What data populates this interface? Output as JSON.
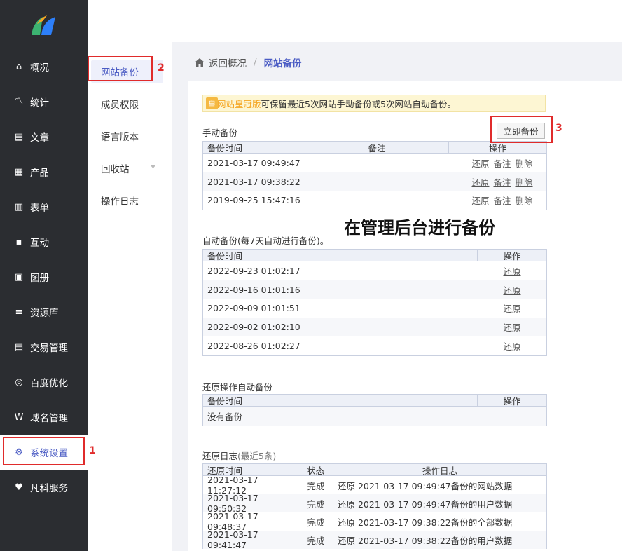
{
  "sidebar": {
    "items": [
      {
        "label": "概况",
        "icon": "home-icon"
      },
      {
        "label": "统计",
        "icon": "chart-icon"
      },
      {
        "label": "文章",
        "icon": "article-icon"
      },
      {
        "label": "产品",
        "icon": "product-icon"
      },
      {
        "label": "表单",
        "icon": "form-icon"
      },
      {
        "label": "互动",
        "icon": "chat-icon"
      },
      {
        "label": "图册",
        "icon": "gallery-icon"
      },
      {
        "label": "资源库",
        "icon": "database-icon"
      },
      {
        "label": "交易管理",
        "icon": "trade-icon"
      },
      {
        "label": "百度优化",
        "icon": "seo-icon"
      },
      {
        "label": "域名管理",
        "icon": "domain-icon"
      },
      {
        "label": "系统设置",
        "icon": "gear-icon"
      },
      {
        "label": "凡科服务",
        "icon": "heart-icon"
      }
    ]
  },
  "submenu": {
    "items": [
      "网站备份",
      "成员权限",
      "语言版本",
      "回收站",
      "操作日志"
    ]
  },
  "breadcrumb": {
    "back": "返回概况",
    "sep": "/",
    "current": "网站备份"
  },
  "notice": {
    "badge": "皇",
    "highlight": "网站皇冠版",
    "text": "可保留最近5次网站手动备份或5次网站自动备份。"
  },
  "manual": {
    "title": "手动备份",
    "button": "立即备份",
    "headers": [
      "备份时间",
      "备注",
      "操作"
    ],
    "rows": [
      [
        "2021-03-17 09:49:47"
      ],
      [
        "2021-03-17 09:38:22"
      ],
      [
        "2019-09-25 15:47:16"
      ]
    ],
    "actions": [
      "还原",
      "备注",
      "删除"
    ]
  },
  "auto": {
    "title": "自动备份(每7天自动进行备份)。",
    "headers": [
      "备份时间",
      "操作"
    ],
    "rows": [
      "2022-09-23 01:02:17",
      "2022-09-16 01:01:16",
      "2022-09-09 01:01:51",
      "2022-09-02 01:02:10",
      "2022-08-26 01:02:27"
    ],
    "action": "还原"
  },
  "restore_auto": {
    "title": "还原操作自动备份",
    "headers": [
      "备份时间",
      "操作"
    ],
    "empty": "没有备份"
  },
  "restore_log": {
    "title": "还原日志",
    "title_note": "(最近5条)",
    "headers": [
      "还原时间",
      "状态",
      "操作日志"
    ],
    "rows": [
      [
        "2021-03-17 11:27:12",
        "完成",
        "还原 2021-03-17 09:49:47备份的网站数据"
      ],
      [
        "2021-03-17 09:50:32",
        "完成",
        "还原 2021-03-17 09:49:47备份的用户数据"
      ],
      [
        "2021-03-17 09:48:37",
        "完成",
        "还原 2021-03-17 09:38:22备份的全部数据"
      ],
      [
        "2021-03-17 09:41:47",
        "完成",
        "还原 2021-03-17 09:38:22备份的用户数据"
      ]
    ]
  },
  "annotation": {
    "title": "在管理后台进行备份",
    "n1": "1",
    "n2": "2",
    "n3": "3"
  },
  "colors": {
    "sidebar": "#2b2d31",
    "accent": "#4b5cc4",
    "red": "#e02b2b"
  }
}
